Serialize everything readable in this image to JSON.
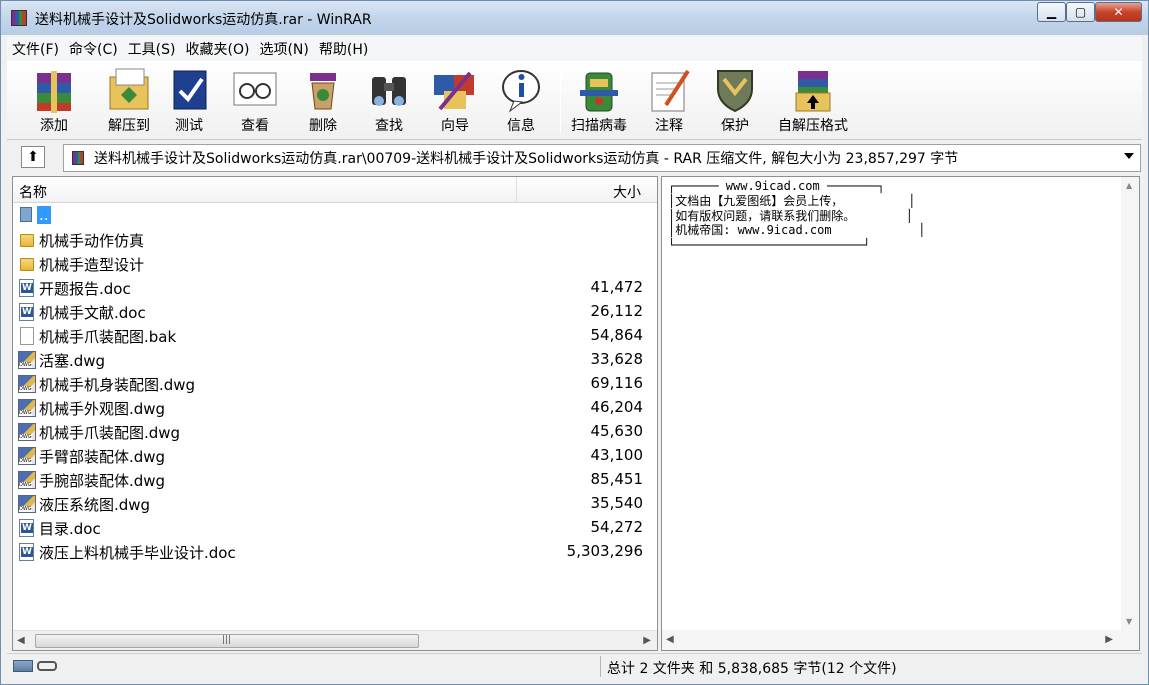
{
  "window": {
    "title": "送料机械手设计及Solidworks运动仿真.rar - WinRAR"
  },
  "menu": [
    "文件(F)",
    "命令(C)",
    "工具(S)",
    "收藏夹(O)",
    "选项(N)",
    "帮助(H)"
  ],
  "toolbar": [
    {
      "label": "添加",
      "icon": "add-archive-icon"
    },
    {
      "label": "解压到",
      "icon": "extract-to-icon"
    },
    {
      "label": "测试",
      "icon": "test-icon"
    },
    {
      "label": "查看",
      "icon": "view-icon"
    },
    {
      "label": "删除",
      "icon": "delete-icon"
    },
    {
      "label": "查找",
      "icon": "find-icon"
    },
    {
      "label": "向导",
      "icon": "wizard-icon"
    },
    {
      "label": "信息",
      "icon": "info-icon"
    },
    {
      "label": "扫描病毒",
      "icon": "virus-scan-icon"
    },
    {
      "label": "注释",
      "icon": "comment-icon"
    },
    {
      "label": "保护",
      "icon": "protect-icon"
    },
    {
      "label": "自解压格式",
      "icon": "sfx-icon"
    }
  ],
  "address": {
    "path": "送料机械手设计及Solidworks运动仿真.rar\\00709-送料机械手设计及Solidworks运动仿真 - RAR 压缩文件, 解包大小为 23,857,297 字节"
  },
  "list": {
    "columns": {
      "name": "名称",
      "size": "大小"
    },
    "rows": [
      {
        "name": "..",
        "size": "",
        "type": "up",
        "selected": true
      },
      {
        "name": "机械手动作仿真",
        "size": "",
        "type": "folder"
      },
      {
        "name": "机械手造型设计",
        "size": "",
        "type": "folder"
      },
      {
        "name": "开题报告.doc",
        "size": "41,472",
        "type": "doc"
      },
      {
        "name": "机械手文献.doc",
        "size": "26,112",
        "type": "doc"
      },
      {
        "name": "机械手爪装配图.bak",
        "size": "54,864",
        "type": "bak"
      },
      {
        "name": "活塞.dwg",
        "size": "33,628",
        "type": "dwg"
      },
      {
        "name": "机械手机身装配图.dwg",
        "size": "69,116",
        "type": "dwg"
      },
      {
        "name": "机械手外观图.dwg",
        "size": "46,204",
        "type": "dwg"
      },
      {
        "name": "机械手爪装配图.dwg",
        "size": "45,630",
        "type": "dwg"
      },
      {
        "name": "手臂部装配体.dwg",
        "size": "43,100",
        "type": "dwg"
      },
      {
        "name": "手腕部装配体.dwg",
        "size": "85,451",
        "type": "dwg"
      },
      {
        "name": "液压系统图.dwg",
        "size": "35,540",
        "type": "dwg"
      },
      {
        "name": "目录.doc",
        "size": "54,272",
        "type": "doc"
      },
      {
        "name": "液压上料机械手毕业设计.doc",
        "size": "5,303,296",
        "type": "doc"
      }
    ]
  },
  "comment": "┌────── www.9icad.com ───────┐\n│文档由【九爱图纸】会员上传，         │\n│如有版权问题，请联系我们删除。       │\n│机械帝国: www.9icad.com            │\n└──────────────────────────┘",
  "status": {
    "summary": "总计 2 文件夹 和 5,838,685 字节(12 个文件)"
  }
}
